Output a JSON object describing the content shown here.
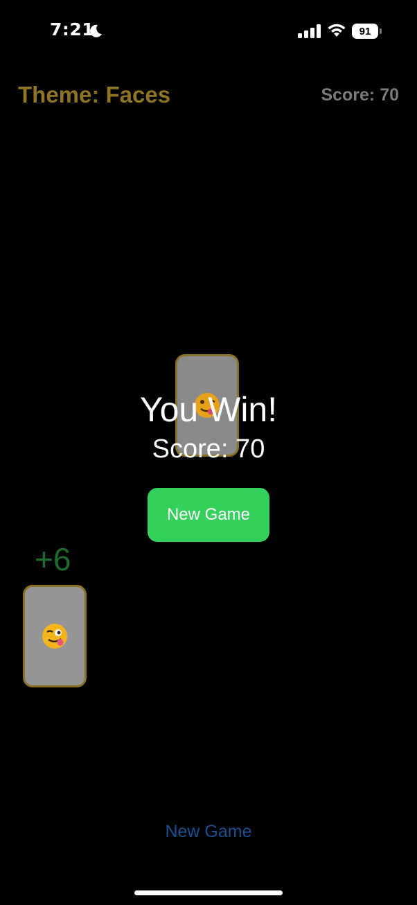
{
  "status_bar": {
    "time": "7:21",
    "battery_level": "91",
    "icons": [
      "moon-icon",
      "signal-icon",
      "wifi-icon",
      "battery-icon"
    ]
  },
  "header": {
    "theme_title": "Theme: Faces",
    "score_label": "Score: 70"
  },
  "cards": [
    {
      "icon": "face-emoji-icon",
      "face": "winking tongue face"
    },
    {
      "icon": "face-emoji-icon",
      "face": "winking tongue face"
    }
  ],
  "points_popup": "+6",
  "overlay": {
    "title": "You Win!",
    "score": "Score: 70",
    "button_label": "New Game"
  },
  "footer": {
    "new_game_label": "New Game"
  },
  "colors": {
    "background": "#000000",
    "theme_title": "#8e7424",
    "card_border": "#8b7125",
    "card_fill": "#8a8a8a",
    "points": "#1f6b2f",
    "primary_button": "#33d15c",
    "link": "#1c4f91"
  }
}
